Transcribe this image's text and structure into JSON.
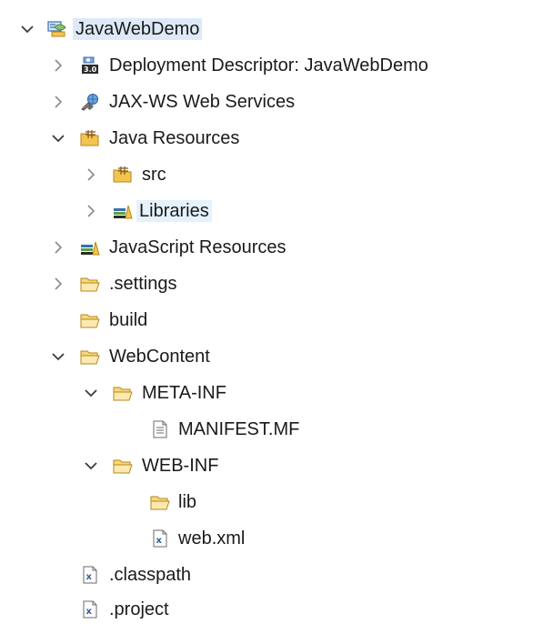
{
  "tree": {
    "items": [
      {
        "label": "JavaWebDemo",
        "icon": "web-project-icon",
        "expander": "expanded"
      },
      {
        "label": "Deployment Descriptor: JavaWebDemo",
        "icon": "deployment-descriptor-icon",
        "expander": "collapsed"
      },
      {
        "label": "JAX-WS Web Services",
        "icon": "web-services-icon",
        "expander": "collapsed"
      },
      {
        "label": "Java Resources",
        "icon": "java-resources-icon",
        "expander": "expanded"
      },
      {
        "label": "src",
        "icon": "source-folder-icon",
        "expander": "collapsed"
      },
      {
        "label": "Libraries",
        "icon": "libraries-icon",
        "expander": "collapsed"
      },
      {
        "label": "JavaScript Resources",
        "icon": "libraries-icon",
        "expander": "collapsed"
      },
      {
        "label": ".settings",
        "icon": "folder-icon",
        "expander": "collapsed"
      },
      {
        "label": "build",
        "icon": "folder-icon",
        "expander": "none"
      },
      {
        "label": "WebContent",
        "icon": "folder-icon",
        "expander": "expanded"
      },
      {
        "label": "META-INF",
        "icon": "folder-icon",
        "expander": "expanded"
      },
      {
        "label": "MANIFEST.MF",
        "icon": "text-file-icon",
        "expander": "none"
      },
      {
        "label": "WEB-INF",
        "icon": "folder-icon",
        "expander": "expanded"
      },
      {
        "label": "lib",
        "icon": "folder-icon",
        "expander": "none"
      },
      {
        "label": "web.xml",
        "icon": "xml-file-icon",
        "expander": "none"
      },
      {
        "label": ".classpath",
        "icon": "xml-file-icon",
        "expander": "none"
      },
      {
        "label": ".project",
        "icon": "xml-file-icon",
        "expander": "none"
      }
    ],
    "selected_item": "Libraries"
  },
  "colors": {
    "selection": "#e5f1fb",
    "folder": "#f3c44f",
    "chevron": "#3c3c3c",
    "text": "#1a1a1a"
  }
}
